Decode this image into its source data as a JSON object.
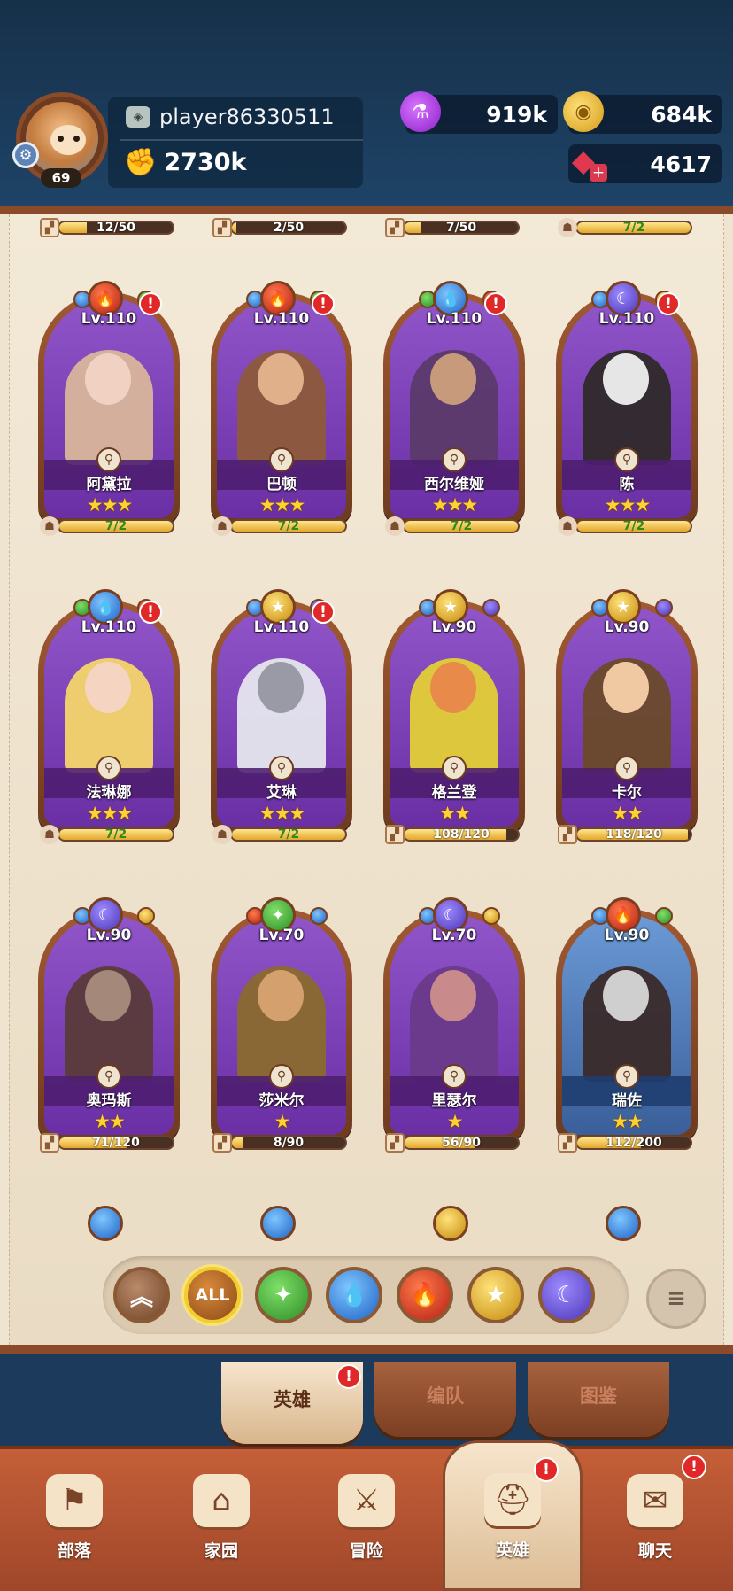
{
  "player": {
    "name": "player86330511",
    "level": "69",
    "power": "2730k"
  },
  "resources": {
    "elixir": "919k",
    "gold": "684k",
    "gems": "4617"
  },
  "partial_row": [
    {
      "progress": "12/50",
      "fraction": 0.24,
      "icon": "puzzle-icon"
    },
    {
      "progress": "2/50",
      "fraction": 0.04,
      "icon": "puzzle-icon"
    },
    {
      "progress": "7/50",
      "fraction": 0.14,
      "icon": "puzzle-icon"
    },
    {
      "progress": "7/2",
      "fraction": 1.0,
      "icon": "helmet-icon"
    }
  ],
  "heroes": [
    {
      "level": "Lv.110",
      "name": "阿黛拉",
      "stars": "★★★",
      "progress": "7/2",
      "fraction": 1.0,
      "element": "fire",
      "alert": "!",
      "icon": "helmet-icon"
    },
    {
      "level": "Lv.110",
      "name": "巴顿",
      "stars": "★★★",
      "progress": "7/2",
      "fraction": 1.0,
      "element": "fire",
      "alert": "!",
      "icon": "helmet-icon"
    },
    {
      "level": "Lv.110",
      "name": "西尔维娅",
      "stars": "★★★",
      "progress": "7/2",
      "fraction": 1.0,
      "element": "water",
      "alert": "!",
      "icon": "helmet-icon"
    },
    {
      "level": "Lv.110",
      "name": "陈",
      "stars": "★★★",
      "progress": "7/2",
      "fraction": 1.0,
      "element": "moon",
      "alert": "!",
      "icon": "helmet-icon"
    },
    {
      "level": "Lv.110",
      "name": "法琳娜",
      "stars": "★★★",
      "progress": "7/2",
      "fraction": 1.0,
      "element": "water",
      "alert": "!",
      "icon": "helmet-icon"
    },
    {
      "level": "Lv.110",
      "name": "艾琳",
      "stars": "★★★",
      "progress": "7/2",
      "fraction": 1.0,
      "element": "star",
      "alert": "!",
      "icon": "helmet-icon"
    },
    {
      "level": "Lv.90",
      "name": "格兰登",
      "stars": "★★",
      "progress": "108/120",
      "fraction": 0.9,
      "element": "star",
      "alert": "",
      "icon": "puzzle-icon"
    },
    {
      "level": "Lv.90",
      "name": "卡尔",
      "stars": "★★",
      "progress": "118/120",
      "fraction": 0.98,
      "element": "star",
      "alert": "",
      "icon": "puzzle-icon"
    },
    {
      "level": "Lv.90",
      "name": "奥玛斯",
      "stars": "★★",
      "progress": "71/120",
      "fraction": 0.59,
      "element": "moon",
      "alert": "",
      "icon": "puzzle-icon"
    },
    {
      "level": "Lv.70",
      "name": "莎米尔",
      "stars": "★",
      "progress": "8/90",
      "fraction": 0.09,
      "element": "leaf",
      "alert": "",
      "icon": "puzzle-icon"
    },
    {
      "level": "Lv.70",
      "name": "里瑟尔",
      "stars": "★",
      "progress": "56/90",
      "fraction": 0.62,
      "element": "moon",
      "alert": "",
      "icon": "puzzle-icon"
    },
    {
      "level": "Lv.90",
      "name": "瑞佐",
      "stars": "★★",
      "progress": "112/200",
      "fraction": 0.56,
      "element": "fire",
      "alert": "",
      "icon": "puzzle-icon"
    }
  ],
  "filters": [
    {
      "id": "up",
      "label": "︽",
      "icon": "rank-up-icon"
    },
    {
      "id": "all",
      "label": "ALL",
      "icon": "all-icon"
    },
    {
      "id": "leaf",
      "label": "✦",
      "icon": "leaf-icon"
    },
    {
      "id": "water",
      "label": "💧",
      "icon": "water-drop-icon"
    },
    {
      "id": "fire",
      "label": "🔥",
      "icon": "flame-icon"
    },
    {
      "id": "star",
      "label": "★",
      "icon": "star-icon"
    },
    {
      "id": "moon",
      "label": "☾",
      "icon": "moon-icon"
    }
  ],
  "selected_filter": "all",
  "sort_label": "≡",
  "subtabs": [
    {
      "label": "英雄",
      "active": true,
      "badge": "!"
    },
    {
      "label": "编队",
      "active": false,
      "badge": ""
    },
    {
      "label": "图鉴",
      "active": false,
      "badge": ""
    }
  ],
  "nav": [
    {
      "label": "部落",
      "icon": "tribe-banner-icon",
      "glyph": "⚑",
      "badge": ""
    },
    {
      "label": "家园",
      "icon": "home-icon",
      "glyph": "⌂",
      "badge": ""
    },
    {
      "label": "冒险",
      "icon": "crossed-swords-icon",
      "glyph": "⚔",
      "badge": ""
    },
    {
      "label": "英雄",
      "icon": "viking-helmet-icon",
      "glyph": "⛑",
      "badge": "!",
      "active": true
    },
    {
      "label": "聊天",
      "icon": "chat-icon",
      "glyph": "✉",
      "badge": "!"
    }
  ]
}
